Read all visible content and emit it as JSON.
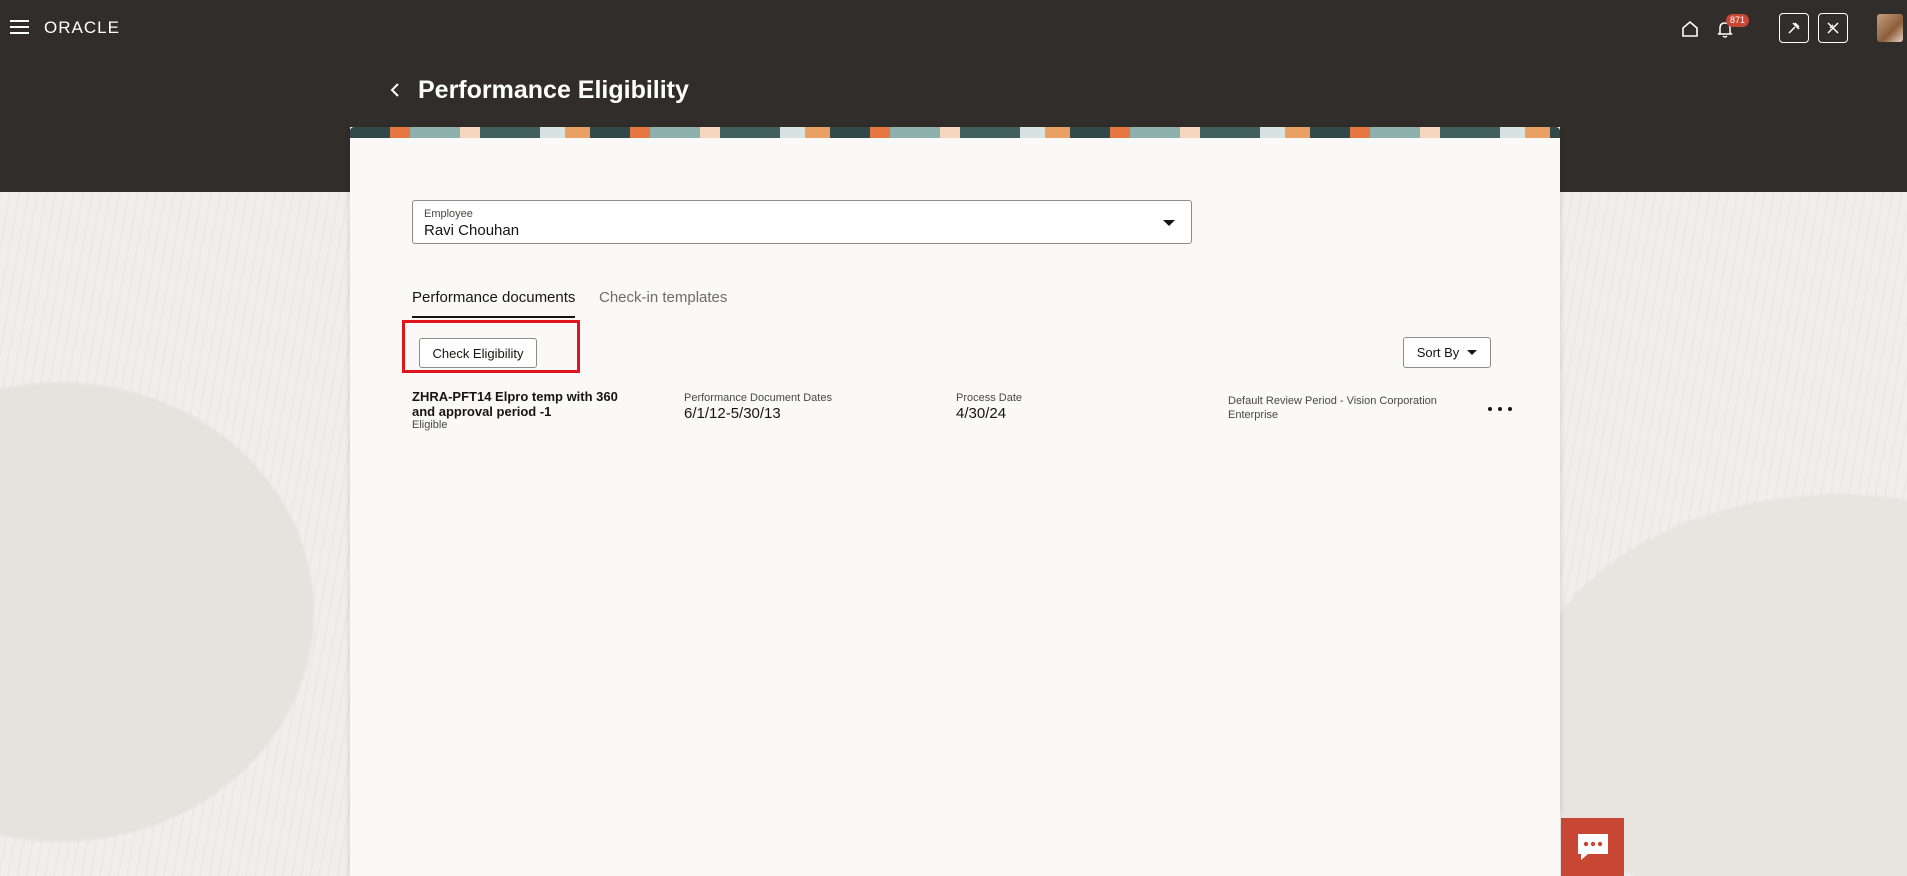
{
  "header": {
    "logo_text": "ORACLE",
    "notification_count": "871",
    "icons": [
      "menu-icon",
      "home-icon",
      "bell-icon",
      "pin-tool-icon",
      "settings-tool-icon",
      "avatar"
    ]
  },
  "page": {
    "title": "Performance Eligibility"
  },
  "employee_field": {
    "label": "Employee",
    "value": "Ravi Chouhan"
  },
  "tabs": [
    {
      "label": "Performance documents",
      "active": true
    },
    {
      "label": "Check-in templates",
      "active": false
    }
  ],
  "toolbar": {
    "check_eligibility_label": "Check Eligibility",
    "sort_by_label": "Sort By"
  },
  "documents": [
    {
      "name": "ZHRA-PFT14 Elpro temp with 360 and approval period -1",
      "status": "Eligible",
      "dates_label": "Performance Document Dates",
      "dates_value": "6/1/12-5/30/13",
      "process_label": "Process Date",
      "process_value": "4/30/24",
      "review_period": "Default Review Period - Vision Corporation Enterprise"
    }
  ],
  "colors": {
    "header_bg": "#312d2a",
    "accent": "#c74634",
    "highlight": "#e0161e"
  }
}
